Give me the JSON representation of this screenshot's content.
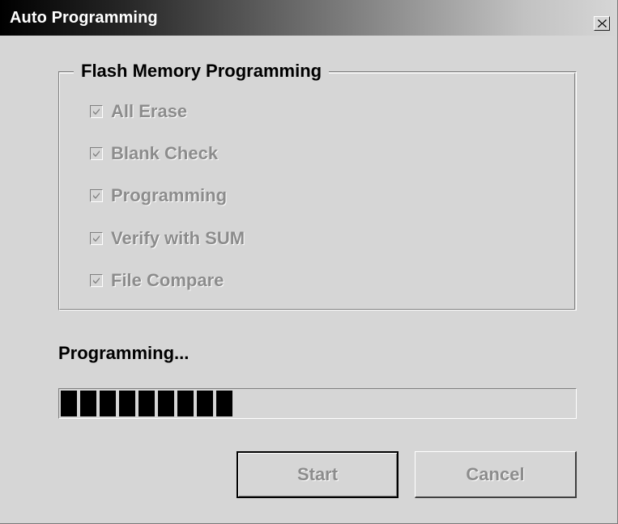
{
  "window": {
    "title": "Auto Programming",
    "close_icon": "close-icon"
  },
  "group": {
    "legend": "Flash Memory Programming",
    "items": [
      {
        "label": "All Erase",
        "checked": true,
        "enabled": false
      },
      {
        "label": "Blank Check",
        "checked": true,
        "enabled": false
      },
      {
        "label": "Programming",
        "checked": true,
        "enabled": false
      },
      {
        "label": "Verify with SUM",
        "checked": true,
        "enabled": false
      },
      {
        "label": "File Compare",
        "checked": true,
        "enabled": false
      }
    ]
  },
  "status": {
    "text": "Programming..."
  },
  "progress": {
    "fraction": 0.34,
    "filled_segments": 9
  },
  "buttons": {
    "start_label": "Start",
    "cancel_label": "Cancel"
  },
  "colors": {
    "face": "#d6d6d6",
    "disabled_text": "#8c8c8c",
    "progress_fill": "#000000"
  }
}
